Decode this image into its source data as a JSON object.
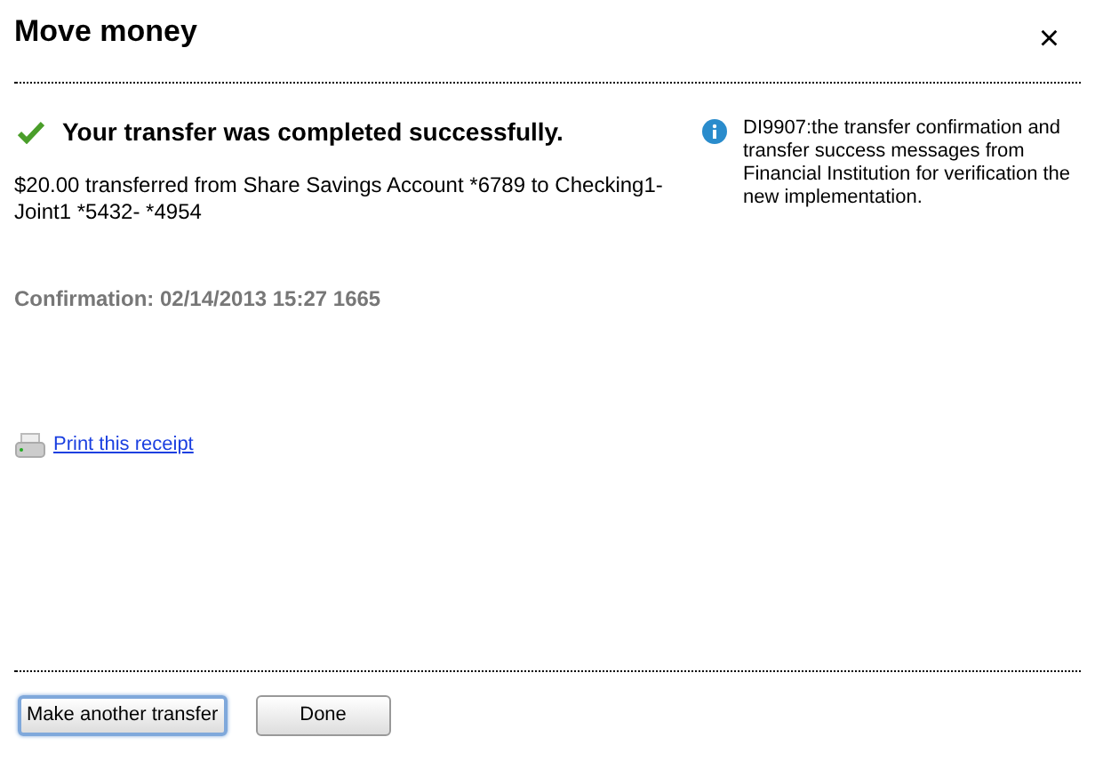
{
  "dialog": {
    "title": "Move money",
    "close": "×"
  },
  "status": {
    "message": "Your transfer was completed successfully.",
    "detail": "$20.00 transferred from Share Savings Account *6789 to Checking1-Joint1 *5432- *4954",
    "confirmation": "Confirmation: 02/14/2013 15:27 1665"
  },
  "info": "DI9907:the transfer confirmation and transfer success messages from Financial Institution for verification the new implementation.",
  "print_link": "Print this receipt",
  "buttons": [
    {
      "label": "Make another transfer",
      "focused": true
    },
    {
      "label": "Done",
      "focused": false
    }
  ]
}
